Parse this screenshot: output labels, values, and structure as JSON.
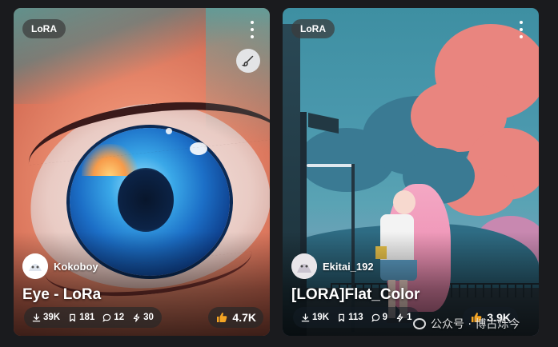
{
  "cards": [
    {
      "badge": "LoRA",
      "author": "Kokoboy",
      "title": "Eye - LoRa",
      "stats": {
        "downloads": "39K",
        "bookmarks": "181",
        "comments": "12",
        "buzz": "30"
      },
      "likes": "4.7K"
    },
    {
      "badge": "LoRA",
      "author": "Ekitai_192",
      "title": "[LORA]Flat_Color",
      "stats": {
        "downloads": "19K",
        "bookmarks": "113",
        "comments": "9",
        "buzz": "1"
      },
      "likes": "3.9K"
    }
  ],
  "watermark": {
    "text": "公众号 · 博古烁今"
  },
  "icons": {
    "download": "download-icon",
    "bookmark": "bookmark-icon",
    "comment": "comment-icon",
    "buzz": "bolt-icon",
    "like": "thumbs-up-icon",
    "menu": "more-vertical-icon",
    "brush": "brush-icon"
  },
  "colors": {
    "background": "#1a1b1e",
    "like_icon": "#f5a524",
    "badge_bg": "#3c3c3c"
  }
}
